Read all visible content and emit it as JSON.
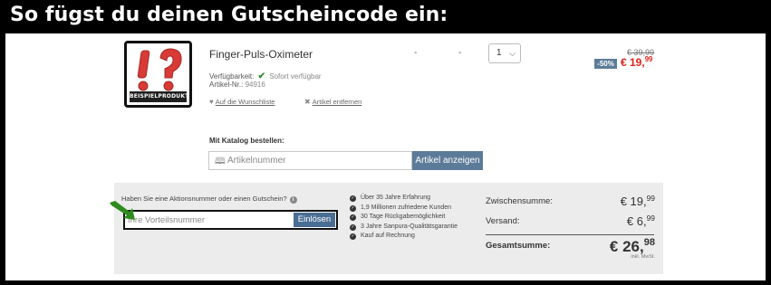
{
  "banner": {
    "title": "So fügst du deinen Gutscheincode ein:"
  },
  "product": {
    "image_badge": "BEISPIELPRODUKT",
    "name": "Finger-Puls-Oximeter",
    "availability_label": "Verfügbarkeit:",
    "availability_value": "Sofort verfügbar",
    "article_no_label": "Artikel-Nr.:",
    "article_no": "94916",
    "wishlist_link": "Auf die Wunschliste",
    "remove_link": "Artikel entfernen",
    "dash_1": "-",
    "dash_2": "-",
    "quantity": "1",
    "price_old": "€ 39,99",
    "discount": "-50%",
    "price_new_main": "€ 19,",
    "price_new_cents": "99"
  },
  "catalog": {
    "label": "Mit Katalog bestellen:",
    "placeholder": "Artikelnummer",
    "button": "Artikel anzeigen"
  },
  "coupon": {
    "question": "Haben Sie eine Aktionsnummer oder einen Gutschein?",
    "info_glyph": "i",
    "placeholder": "Ihre Vorteilsnummer",
    "button": "Einlösen"
  },
  "benefits": [
    "Über 35 Jahre Erfahrung",
    "1,9 Millionen zufriedene Kunden",
    "30 Tage Rückgabemöglichkeit",
    "3 Jahre Sanpura-Qualitätsgarantie",
    "Kauf auf Rechnung"
  ],
  "summary": {
    "subtotal_label": "Zwischensumme:",
    "subtotal_main": "€ 19,",
    "subtotal_cents": "99",
    "shipping_label": "Versand:",
    "shipping_main": "€ 6,",
    "shipping_cents": "99",
    "total_label": "Gesamtsumme:",
    "total_main": "€ 26,",
    "total_cents": "98",
    "vat_note": "inkl. MwSt."
  },
  "colors": {
    "accent": "#5c7b99",
    "price_red": "#e0201b",
    "arrow_green": "#2e8b1e",
    "check_green": "#2e8b2e"
  }
}
